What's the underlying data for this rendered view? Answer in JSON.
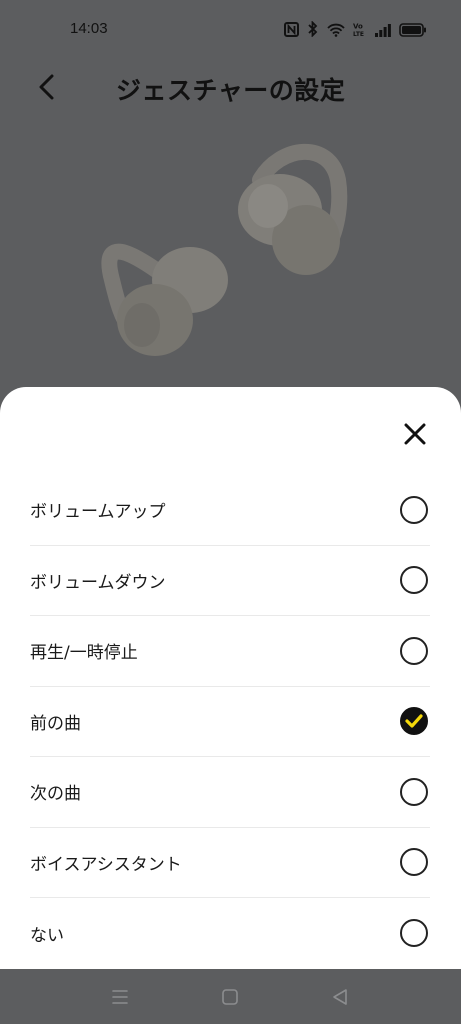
{
  "status_bar": {
    "time": "14:03",
    "icons": [
      "nfc-icon",
      "bluetooth-icon",
      "wifi-icon",
      "volte-icon",
      "signal-icon",
      "battery-icon"
    ],
    "volte_label": "Vo\nLTE"
  },
  "header": {
    "title": "ジェスチャーの設定",
    "back_icon": "chevron-left-icon"
  },
  "sheet": {
    "close_icon": "close-icon",
    "options": [
      {
        "label": "ボリュームアップ",
        "selected": false
      },
      {
        "label": "ボリュームダウン",
        "selected": false
      },
      {
        "label": "再生/一時停止",
        "selected": false
      },
      {
        "label": "前の曲",
        "selected": true
      },
      {
        "label": "次の曲",
        "selected": false
      },
      {
        "label": "ボイスアシスタント",
        "selected": false
      },
      {
        "label": "ない",
        "selected": false
      }
    ]
  },
  "nav_bar": {
    "buttons": [
      "menu-icon",
      "home-icon",
      "back-icon"
    ]
  },
  "colors": {
    "overlay_background": "#5c5d5f",
    "sheet_background": "#ffffff",
    "check_accent": "#f5d90a"
  }
}
